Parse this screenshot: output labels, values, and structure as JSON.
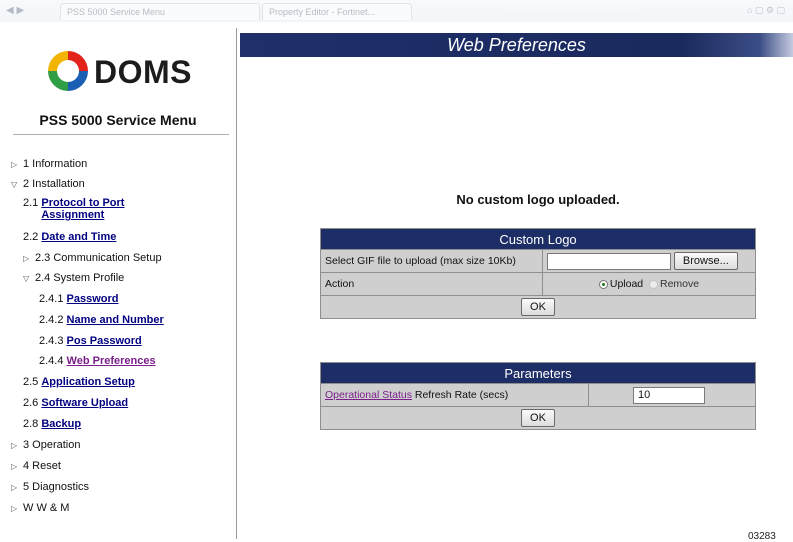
{
  "browser": {
    "tabs": [
      "PSS 5000 Service Menu",
      "Property Editor - Fortinet..."
    ]
  },
  "sidebar": {
    "logo_text": "DOMS",
    "menu_title": "PSS 5000 Service Menu",
    "items": [
      {
        "num": "",
        "label": "1 Information",
        "link": false
      },
      {
        "num": "",
        "label": "2 Installation",
        "link": false
      },
      {
        "num": "2.1",
        "label": "Protocol to Port Assignment",
        "link": true
      },
      {
        "num": "2.2",
        "label": "Date and Time",
        "link": true
      },
      {
        "num": "",
        "label": "2.3 Communication Setup",
        "link": false
      },
      {
        "num": "",
        "label": "2.4 System Profile",
        "link": false
      },
      {
        "num": "2.4.1",
        "label": "Password",
        "link": true
      },
      {
        "num": "2.4.2",
        "label": "Name and Number",
        "link": true
      },
      {
        "num": "2.4.3",
        "label": "Pos Password",
        "link": true
      },
      {
        "num": "2.4.4",
        "label": "Web Preferences",
        "link": true
      },
      {
        "num": "2.5",
        "label": "Application Setup",
        "link": true
      },
      {
        "num": "2.6",
        "label": "Software Upload",
        "link": true
      },
      {
        "num": "2.8",
        "label": "Backup",
        "link": true
      },
      {
        "num": "",
        "label": "3 Operation",
        "link": false
      },
      {
        "num": "",
        "label": "4 Reset",
        "link": false
      },
      {
        "num": "",
        "label": "5 Diagnostics",
        "link": false
      },
      {
        "num": "",
        "label": "W W & M",
        "link": false
      }
    ]
  },
  "main": {
    "page_title": "Web Preferences",
    "status_message": "No custom logo uploaded.",
    "custom_logo": {
      "header": "Custom Logo",
      "file_label": "Select GIF file to upload (max size 10Kb)",
      "file_value": "",
      "browse_label": "Browse...",
      "action_label": "Action",
      "upload_label": "Upload",
      "remove_label": "Remove",
      "ok_label": "OK"
    },
    "parameters": {
      "header": "Parameters",
      "link_text": "Operational Status",
      "label_rest": " Refresh Rate (secs)",
      "refresh_value": "10",
      "ok_label": "OK"
    }
  },
  "corner_text": "03283"
}
